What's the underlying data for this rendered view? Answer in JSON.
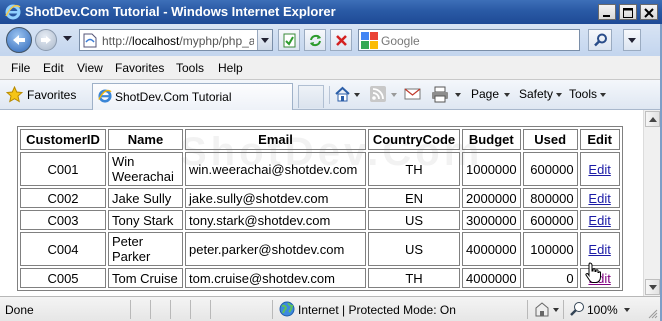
{
  "window": {
    "title": "ShotDev.Com Tutorial - Windows Internet Explorer",
    "minimize": "minimize",
    "maximize": "maximize",
    "close": "close"
  },
  "address_bar": {
    "url_prefix": "http://",
    "url_host": "localhost",
    "url_path": "/myphp/php_ad"
  },
  "search": {
    "placeholder": "Google"
  },
  "menu": {
    "items": [
      "File",
      "Edit",
      "View",
      "Favorites",
      "Tools",
      "Help"
    ]
  },
  "command_bar": {
    "favorites": "Favorites",
    "tab_title": "ShotDev.Com Tutorial",
    "page": "Page",
    "safety": "Safety",
    "tools": "Tools"
  },
  "watermark": "ShotDev.Com",
  "table": {
    "headers": [
      "CustomerID",
      "Name",
      "Email",
      "CountryCode",
      "Budget",
      "Used",
      "Edit"
    ],
    "rows": [
      {
        "id": "C001",
        "name": "Win Weerachai",
        "email": "win.weerachai@shotdev.com",
        "country": "TH",
        "budget": "1000000",
        "used": "600000",
        "edit": "Edit"
      },
      {
        "id": "C002",
        "name": "Jake Sully",
        "email": "jake.sully@shotdev.com",
        "country": "EN",
        "budget": "2000000",
        "used": "800000",
        "edit": "Edit"
      },
      {
        "id": "C003",
        "name": "Tony Stark",
        "email": "tony.stark@shotdev.com",
        "country": "US",
        "budget": "3000000",
        "used": "600000",
        "edit": "Edit"
      },
      {
        "id": "C004",
        "name": "Peter Parker",
        "email": "peter.parker@shotdev.com",
        "country": "US",
        "budget": "4000000",
        "used": "100000",
        "edit": "Edit"
      },
      {
        "id": "C005",
        "name": "Tom Cruise",
        "email": "tom.cruise@shotdev.com",
        "country": "TH",
        "budget": "4000000",
        "used": "0",
        "edit": "Edit"
      }
    ]
  },
  "status_bar": {
    "status": "Done",
    "zone": "Internet | Protected Mode: On",
    "zoom": "100%"
  },
  "colors": {
    "title_bar": "#2a5aa5",
    "link": "#1a1aa6",
    "visited_link": "#800080"
  },
  "icons": [
    "ie-logo-icon",
    "back-arrow-icon",
    "forward-arrow-icon",
    "page-icon",
    "compatibility-icon",
    "refresh-icon",
    "stop-icon",
    "google-icon",
    "search-icon",
    "star-icon",
    "home-icon",
    "rss-icon",
    "mail-icon",
    "print-icon",
    "globe-icon",
    "hand-cursor-icon"
  ]
}
